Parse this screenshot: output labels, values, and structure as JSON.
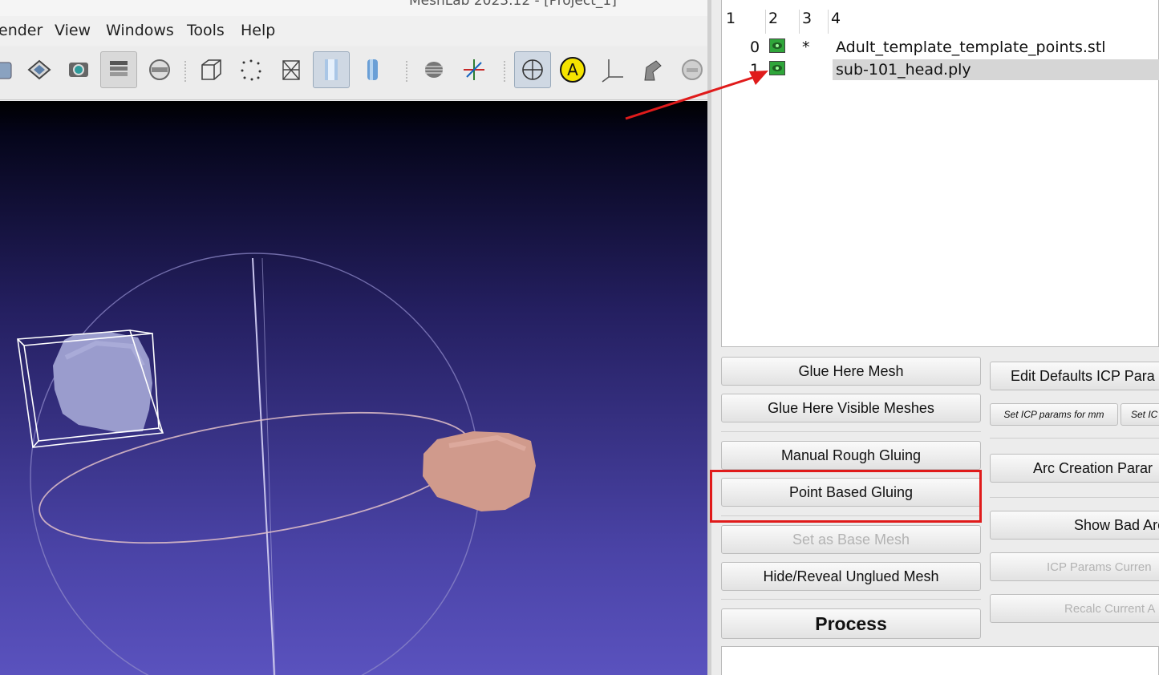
{
  "window": {
    "title": "MeshLab 2023.12 - [Project_1]"
  },
  "menu": {
    "items": [
      "ender",
      "View",
      "Windows",
      "Tools",
      "Help"
    ]
  },
  "toolbar": {
    "icons": [
      "save-icon",
      "paint-bucket-icon",
      "snapshot-icon",
      "layers-icon",
      "raster-icon",
      "bounding-box-icon",
      "points-icon",
      "wireframe-icon",
      "flat-shading-icon",
      "smooth-shading-icon",
      "texture-icon",
      "axes-gizmo-icon",
      "trackball-icon",
      "light-icon",
      "axis-icon",
      "align-tool-icon",
      "render-icon"
    ]
  },
  "layers": {
    "headers": [
      "1",
      "2",
      "3",
      "4"
    ],
    "rows": [
      {
        "index": "0",
        "marker": "*",
        "name": "Adult_template_template_points.stl",
        "selected": false
      },
      {
        "index": "1",
        "marker": "",
        "name": "sub-101_head.ply",
        "selected": true
      }
    ]
  },
  "align_buttons": {
    "glue_here_mesh": "Glue Here Mesh",
    "glue_visible": "Glue Here Visible Meshes",
    "manual_rough": "Manual Rough Gluing",
    "point_based": "Point Based Gluing",
    "set_base": "Set as Base Mesh",
    "hide_reveal": "Hide/Reveal Unglued Mesh",
    "process": "Process",
    "edit_icp": "Edit Defaults ICP Para",
    "set_icp_mm": "Set ICP params for mm",
    "set_icp_other": "Set IC",
    "arc_params": "Arc Creation Parar",
    "show_bad": "Show Bad Arc",
    "icp_current": "ICP Params Curren",
    "recalc": "Recalc Current A"
  },
  "colors": {
    "highlight": "#e01b1b",
    "head_template": "#9a9ccd",
    "head_subject": "#d09a8c"
  }
}
